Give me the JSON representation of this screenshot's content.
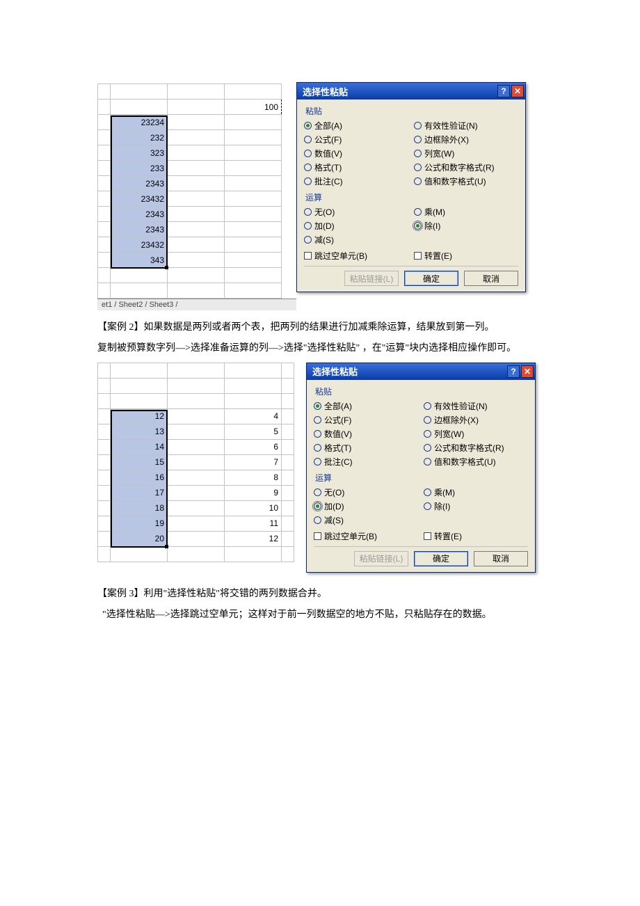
{
  "figure1": {
    "sheet": {
      "marquee_cell": "100",
      "col_values": [
        "23234",
        "232",
        "323",
        "233",
        "2343",
        "23432",
        "2343",
        "2343",
        "23432",
        "343"
      ],
      "tabs": "et1 / Sheet2 / Sheet3 /"
    },
    "dialog": {
      "title": "选择性粘贴",
      "section_paste": "粘贴",
      "section_op": "运算",
      "paste_opts_left": [
        "全部(A)",
        "公式(F)",
        "数值(V)",
        "格式(T)",
        "批注(C)"
      ],
      "paste_opts_right": [
        "有效性验证(N)",
        "边框除外(X)",
        "列宽(W)",
        "公式和数字格式(R)",
        "值和数字格式(U)"
      ],
      "paste_checked_index": 0,
      "op_opts_left": [
        "无(O)",
        "加(D)",
        "减(S)"
      ],
      "op_opts_right": [
        "乘(M)",
        "除(I)"
      ],
      "op_checked_right_index": 1,
      "op_highlight_right_index": 1,
      "skip_blanks": "跳过空单元(B)",
      "transpose": "转置(E)",
      "paste_link": "粘贴链接(L)",
      "ok": "确定",
      "cancel": "取消"
    }
  },
  "para1": "【案例 2】如果数据是两列或者两个表，把两列的结果进行加减乘除运算，结果放到第一列。",
  "para2": "复制被预算数字列—>选择准备运算的列—>选择\"选择性粘贴\"   ，在\"运算\"块内选择相应操作即可。",
  "figure2": {
    "sheet": {
      "colA": [
        "12",
        "13",
        "14",
        "15",
        "16",
        "17",
        "18",
        "19",
        "20"
      ],
      "colC": [
        "4",
        "5",
        "6",
        "7",
        "8",
        "9",
        "10",
        "11",
        "12"
      ]
    },
    "dialog": {
      "title": "选择性粘贴",
      "section_paste": "粘贴",
      "section_op": "运算",
      "paste_opts_left": [
        "全部(A)",
        "公式(F)",
        "数值(V)",
        "格式(T)",
        "批注(C)"
      ],
      "paste_opts_right": [
        "有效性验证(N)",
        "边框除外(X)",
        "列宽(W)",
        "公式和数字格式(R)",
        "值和数字格式(U)"
      ],
      "paste_checked_index": 0,
      "op_opts_left": [
        "无(O)",
        "加(D)",
        "减(S)"
      ],
      "op_opts_right": [
        "乘(M)",
        "除(I)"
      ],
      "op_checked_left_index": 1,
      "op_highlight_left_index": 1,
      "skip_blanks": "跳过空单元(B)",
      "transpose": "转置(E)",
      "paste_link": "粘贴链接(L)",
      "ok": "确定",
      "cancel": "取消"
    }
  },
  "para3": "【案例 3】利用\"选择性粘贴\"将交错的两列数据合并。",
  "para4": "  \"选择性粘贴—>选择跳过空单元；这样对于前一列数据空的地方不贴，只粘贴存在的数据。"
}
